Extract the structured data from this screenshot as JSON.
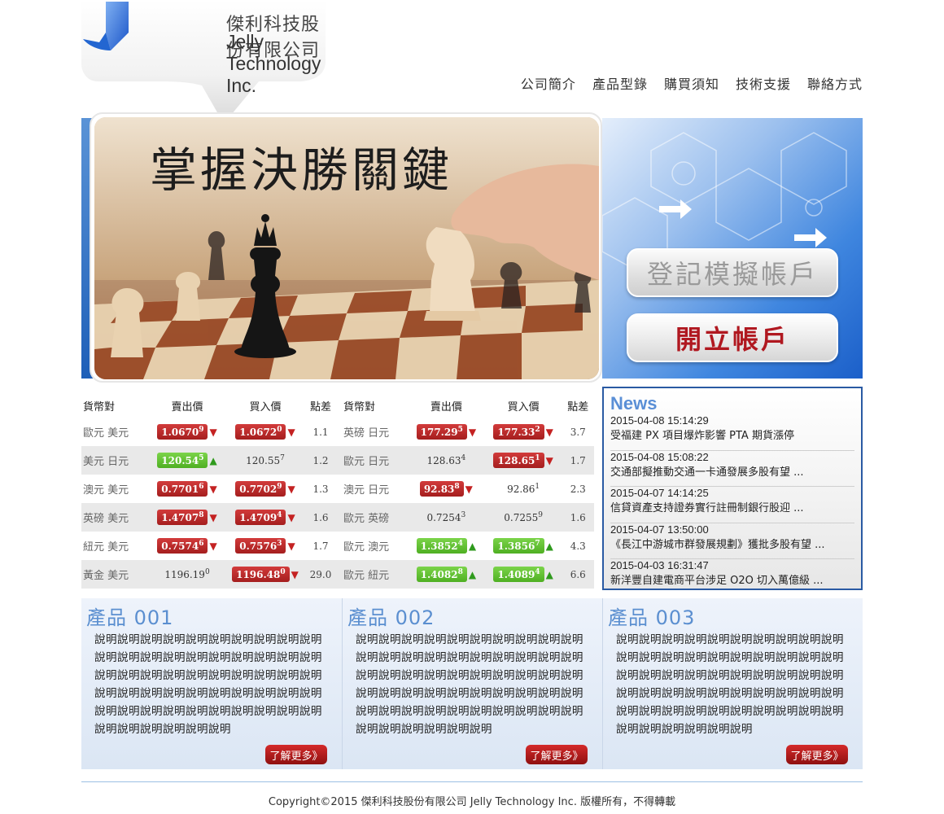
{
  "brand": {
    "name_cn": "傑利科技股份有限公司",
    "name_en": "Jelly Technology Inc."
  },
  "nav": [
    "公司簡介",
    "產品型錄",
    "購買須知",
    "技術支援",
    "聯絡方式"
  ],
  "hero": {
    "title": "掌握決勝關鍵",
    "btn_sim": "登記模擬帳戶",
    "btn_open": "開立帳戶"
  },
  "forex": {
    "headers": [
      "貨幣對",
      "賣出價",
      "買入價",
      "點差"
    ],
    "left": [
      {
        "pair": "歐元 美元",
        "sell": "1.0670",
        "sell_sup": "9",
        "sell_style": "red",
        "sell_dir": "down",
        "buy": "1.0672",
        "buy_sup": "0",
        "buy_style": "red",
        "buy_dir": "down",
        "spread": "1.1"
      },
      {
        "pair": "美元 日元",
        "sell": "120.54",
        "sell_sup": "5",
        "sell_style": "green",
        "sell_dir": "up",
        "buy": "120.55",
        "buy_sup": "7",
        "buy_style": "plain",
        "buy_dir": "",
        "spread": "1.2"
      },
      {
        "pair": "澳元 美元",
        "sell": "0.7701",
        "sell_sup": "6",
        "sell_style": "red",
        "sell_dir": "down",
        "buy": "0.7702",
        "buy_sup": "9",
        "buy_style": "red",
        "buy_dir": "down",
        "spread": "1.3"
      },
      {
        "pair": "英磅 美元",
        "sell": "1.4707",
        "sell_sup": "8",
        "sell_style": "red",
        "sell_dir": "down",
        "buy": "1.4709",
        "buy_sup": "4",
        "buy_style": "red",
        "buy_dir": "down",
        "spread": "1.6"
      },
      {
        "pair": "紐元 美元",
        "sell": "0.7574",
        "sell_sup": "6",
        "sell_style": "red",
        "sell_dir": "down",
        "buy": "0.7576",
        "buy_sup": "3",
        "buy_style": "red",
        "buy_dir": "down",
        "spread": "1.7"
      },
      {
        "pair": "黃金 美元",
        "sell": "1196.19",
        "sell_sup": "0",
        "sell_style": "plain",
        "sell_dir": "",
        "buy": "1196.48",
        "buy_sup": "0",
        "buy_style": "red",
        "buy_dir": "down",
        "spread": "29.0"
      }
    ],
    "right": [
      {
        "pair": "英磅 日元",
        "sell": "177.29",
        "sell_sup": "5",
        "sell_style": "red",
        "sell_dir": "down",
        "buy": "177.33",
        "buy_sup": "2",
        "buy_style": "red",
        "buy_dir": "down",
        "spread": "3.7"
      },
      {
        "pair": "歐元 日元",
        "sell": "128.63",
        "sell_sup": "4",
        "sell_style": "plain",
        "sell_dir": "",
        "buy": "128.65",
        "buy_sup": "1",
        "buy_style": "red",
        "buy_dir": "down",
        "spread": "1.7"
      },
      {
        "pair": "澳元 日元",
        "sell": "92.83",
        "sell_sup": "8",
        "sell_style": "red",
        "sell_dir": "down",
        "buy": "92.86",
        "buy_sup": "1",
        "buy_style": "plain",
        "buy_dir": "",
        "spread": "2.3"
      },
      {
        "pair": "歐元 英磅",
        "sell": "0.7254",
        "sell_sup": "3",
        "sell_style": "plain",
        "sell_dir": "",
        "buy": "0.7255",
        "buy_sup": "9",
        "buy_style": "plain",
        "buy_dir": "",
        "spread": "1.6"
      },
      {
        "pair": "歐元 澳元",
        "sell": "1.3852",
        "sell_sup": "4",
        "sell_style": "green",
        "sell_dir": "up",
        "buy": "1.3856",
        "buy_sup": "7",
        "buy_style": "green",
        "buy_dir": "up",
        "spread": "4.3"
      },
      {
        "pair": "歐元 紐元",
        "sell": "1.4082",
        "sell_sup": "8",
        "sell_style": "green",
        "sell_dir": "up",
        "buy": "1.4089",
        "buy_sup": "4",
        "buy_style": "green",
        "buy_dir": "up",
        "spread": "6.6"
      }
    ]
  },
  "news": {
    "title": "News",
    "items": [
      {
        "date": "2015-04-08 15:14:29",
        "text": "受福建 PX 項目爆炸影響 PTA 期貨漲停"
      },
      {
        "date": "2015-04-08 15:08:22",
        "text": "交通部擬推動交通一卡通發展多股有望 ..."
      },
      {
        "date": "2015-04-07 14:14:25",
        "text": "信貸資產支持證券實行註冊制銀行股迎 ..."
      },
      {
        "date": "2015-04-07 13:50:00",
        "text": "《長江中游城市群發展規劃》獲批多股有望 ..."
      },
      {
        "date": "2015-04-03 16:31:47",
        "text": "新洋豐自建電商平台涉足 O2O 切入萬億級 ..."
      }
    ]
  },
  "products": [
    {
      "title": "產品 001",
      "desc": "說明說明說明說明說明說明說明說明說明說明說明說明說明說明說明說明說明說明說明說明說明說明說明說明說明說明說明說明說明說明說明說明說明說明說明說明說明說明說明說明說明說明說明說明說明說明說明說明說明說明說明說明說明說明說明說明",
      "more": "了解更多》"
    },
    {
      "title": "產品 002",
      "desc": "說明說明說明說明說明說明說明說明說明說明說明說明說明說明說明說明說明說明說明說明說明說明說明說明說明說明說明說明說明說明說明說明說明說明說明說明說明說明說明說明說明說明說明說明說明說明說明說明說明說明說明說明說明說明說明說明",
      "more": "了解更多》"
    },
    {
      "title": "產品 003",
      "desc": "說明說明說明說明說明說明說明說明說明說明說明說明說明說明說明說明說明說明說明說明說明說明說明說明說明說明說明說明說明說明說明說明說明說明說明說明說明說明說明說明說明說明說明說明說明說明說明說明說明說明說明說明說明說明說明說明",
      "more": "了解更多》"
    }
  ],
  "footer": "Copyright©2015 傑利科技股份有限公司 Jelly Technology Inc. 版權所有，不得轉載"
}
